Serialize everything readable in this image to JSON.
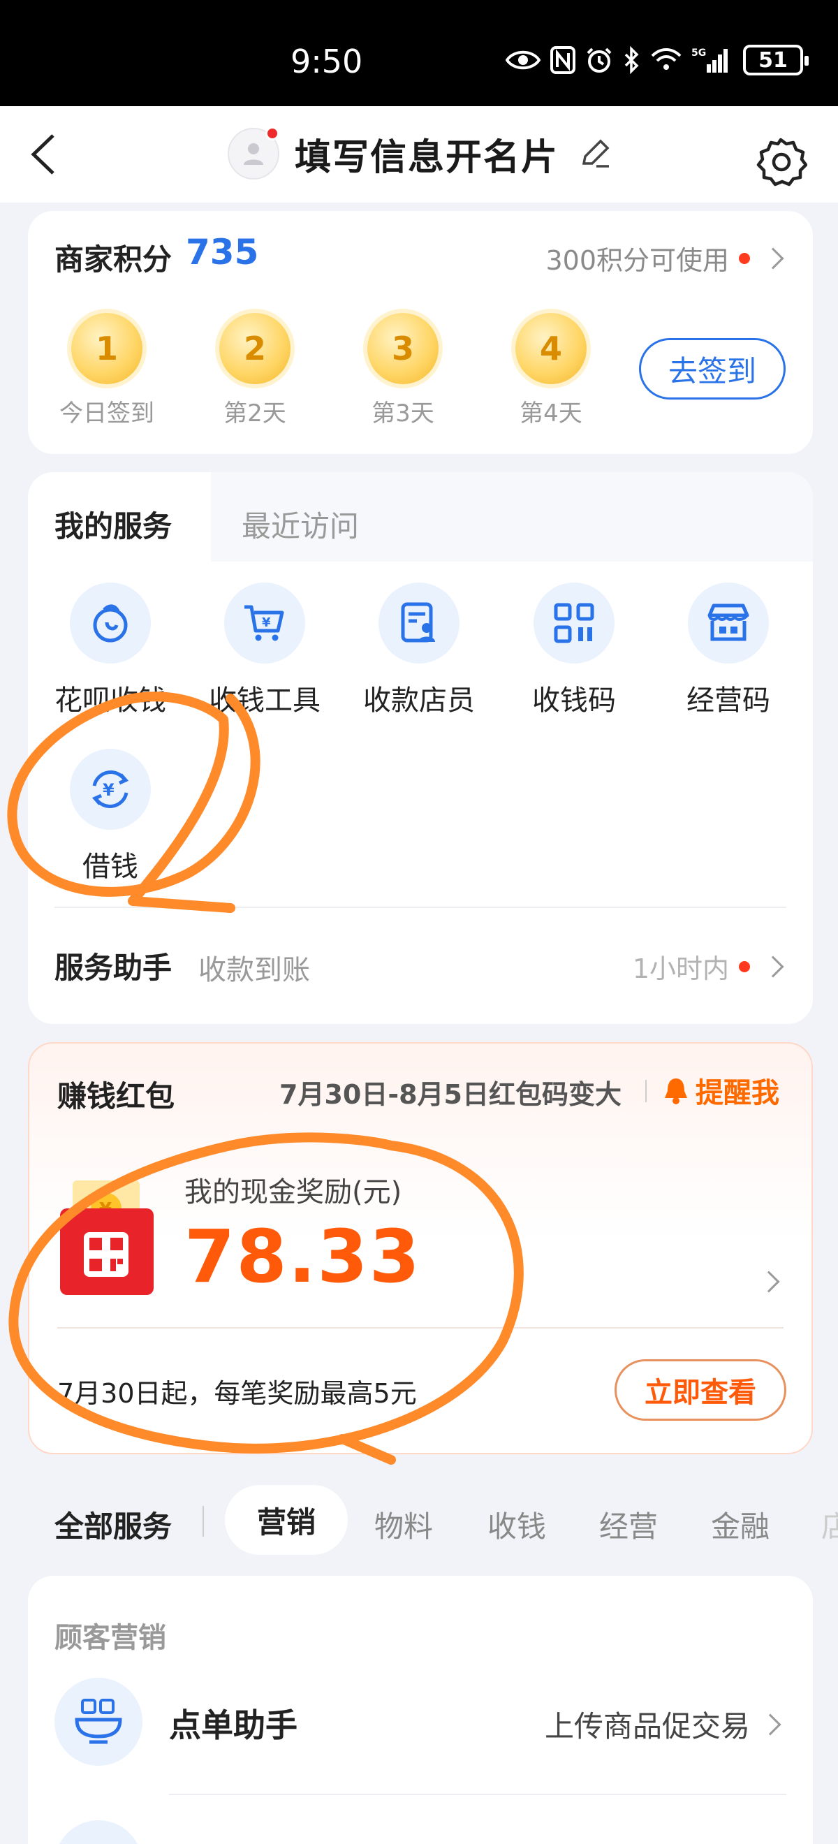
{
  "status_bar": {
    "time": "9:50",
    "network": "5G",
    "battery": "51"
  },
  "nav": {
    "title": "填写信息开名片"
  },
  "points": {
    "title": "商家积分",
    "value": "735",
    "link_text": "300积分可使用",
    "days": [
      {
        "num": "1",
        "label": "今日签到"
      },
      {
        "num": "2",
        "label": "第2天"
      },
      {
        "num": "3",
        "label": "第3天"
      },
      {
        "num": "4",
        "label": "第4天"
      }
    ],
    "signin_button": "去签到"
  },
  "services": {
    "tab_active": "我的服务",
    "tab_inactive": "最近访问",
    "items": [
      {
        "label": "花呗收钱",
        "icon": "huabei-icon"
      },
      {
        "label": "收钱工具",
        "icon": "cart-yuan-icon"
      },
      {
        "label": "收款店员",
        "icon": "clerk-icon"
      },
      {
        "label": "收钱码",
        "icon": "qr-code-icon"
      },
      {
        "label": "经营码",
        "icon": "store-icon"
      },
      {
        "label": "借钱",
        "icon": "loan-icon"
      }
    ],
    "assistant": {
      "title": "服务助手",
      "subtitle": "收款到账",
      "status": "1小时内"
    }
  },
  "red_packet": {
    "title": "赚钱红包",
    "promo": "7月30日-8月5日红包码变大",
    "remind": "提醒我",
    "reward_label": "我的现金奖励(元)",
    "amount": "78.33",
    "note": "7月30日起，每笔奖励最高5元",
    "view_button": "立即查看"
  },
  "all_services": {
    "label": "全部服务",
    "tabs": [
      "营销",
      "物料",
      "收钱",
      "经营",
      "金融",
      "店"
    ]
  },
  "marketing": {
    "section_title": "顾客营销",
    "item": {
      "name": "点单助手",
      "desc": "上传商品促交易"
    }
  },
  "colors": {
    "accent": "#2a72e8",
    "orange": "#ff5a0a",
    "annotation": "#ff8a2a"
  }
}
